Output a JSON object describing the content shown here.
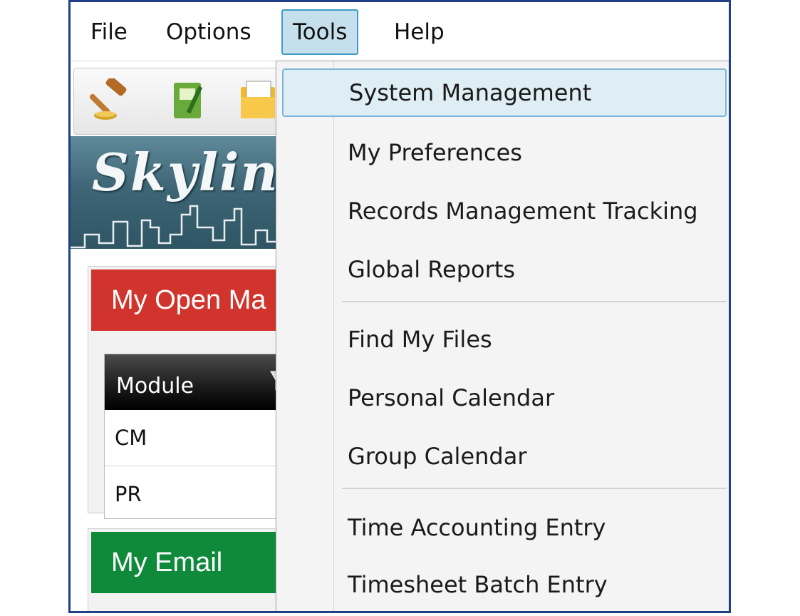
{
  "menubar": {
    "items": [
      {
        "label": "File"
      },
      {
        "label": "Options"
      },
      {
        "label": "Tools"
      },
      {
        "label": "Help"
      }
    ],
    "active": "Tools"
  },
  "toolbar": {
    "icons": [
      "gavel-icon",
      "notebook-icon",
      "folder-icon"
    ]
  },
  "banner": {
    "text": "Skylin"
  },
  "panels": {
    "open_matters": {
      "title": "My Open Ma",
      "color": "#d0342c",
      "grid": {
        "column_header": "Module",
        "rows": [
          "CM",
          "PR"
        ]
      }
    },
    "email": {
      "title": "My Email",
      "color": "#0f8a3a"
    }
  },
  "tools_menu": {
    "groups": [
      [
        "System Management",
        "My Preferences",
        "Records Management Tracking",
        "Global Reports"
      ],
      [
        "Find My Files",
        "Personal Calendar",
        "Group Calendar"
      ],
      [
        "Time Accounting Entry",
        "Timesheet Batch Entry"
      ]
    ],
    "highlighted": "System Management"
  },
  "colors": {
    "frame_border": "#1f3f86",
    "menu_highlight": "#c5e0ec",
    "item_highlight": "#dfeef5"
  }
}
